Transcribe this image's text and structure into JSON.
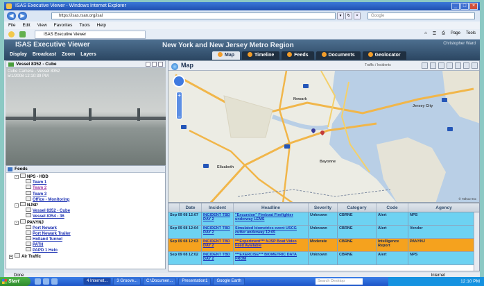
{
  "window": {
    "title": "ISAS Executive Viewer - Windows Internet Explorer"
  },
  "browser": {
    "url": "https://isas.rsan.org/isal",
    "search_placeholder": "Google",
    "menu": [
      "File",
      "Edit",
      "View",
      "Favorites",
      "Tools",
      "Help"
    ],
    "tab_label": "ISAS Executive Viewer",
    "commands": [
      "Page",
      "Tools"
    ]
  },
  "app": {
    "title": "ISAS Executive Viewer",
    "region": "New York and New Jersey Metro Region",
    "user": "Christopher Ward",
    "left_buttons": [
      "Display",
      "Broadcast",
      "Zoom",
      "Layers"
    ],
    "tabs": [
      {
        "label": "Map",
        "active": true
      },
      {
        "label": "Timeline",
        "active": false
      },
      {
        "label": "Feeds",
        "active": false
      },
      {
        "label": "Documents",
        "active": false
      },
      {
        "label": "Geolocator",
        "active": false
      }
    ]
  },
  "camera": {
    "header": "Vessel 8352 - Cube",
    "overlay_line1": "Cube Camera - Vessel 8352",
    "overlay_line2": "5/1/2008 12:10:39 PM"
  },
  "feeds": {
    "header": "Feeds",
    "tree": [
      {
        "level": 1,
        "toggle": "-",
        "text": "NPS - HDD",
        "link": false
      },
      {
        "level": 3,
        "text": "Team 1",
        "link": true,
        "visited": false
      },
      {
        "level": 3,
        "text": "Team 2",
        "link": true,
        "visited": true
      },
      {
        "level": 3,
        "text": "Team 3",
        "link": true,
        "visited": false
      },
      {
        "level": 3,
        "text": "Office - Monitoring",
        "link": true,
        "visited": false
      },
      {
        "level": 1,
        "toggle": "-",
        "text": "NJSP",
        "link": false
      },
      {
        "level": 3,
        "text": "Vessel 8352 - Cube",
        "link": true,
        "visited": false
      },
      {
        "level": 3,
        "text": "Vessel 8354 - 36",
        "link": true,
        "visited": false
      },
      {
        "level": 1,
        "toggle": "-",
        "text": "PANYNJ",
        "link": false
      },
      {
        "level": 3,
        "text": "Port Newark",
        "link": true,
        "visited": false
      },
      {
        "level": 3,
        "text": "Port Newark Trailer",
        "link": true,
        "visited": false
      },
      {
        "level": 3,
        "text": "Holland Tunnel",
        "link": true,
        "visited": false
      },
      {
        "level": 3,
        "text": "PATH",
        "link": true,
        "visited": false
      },
      {
        "level": 3,
        "text": "PAPD 1 Helo",
        "link": true,
        "visited": false
      },
      {
        "level": 0,
        "toggle": "+",
        "text": "Air Traffic",
        "link": false
      }
    ]
  },
  "map": {
    "title": "Map",
    "note": "Traffic / Incidents",
    "labels": [
      "Newark",
      "Jersey City",
      "Elizabeth",
      "Bayonne"
    ],
    "copyright": "© Yahoo! Inc"
  },
  "incidents": {
    "columns": [
      "Date",
      "Incident",
      "Headline",
      "Severity",
      "Category",
      "Code",
      "Agency"
    ],
    "rows": [
      {
        "style": "blue",
        "date": "Sep 09 08 12:07",
        "incident": "INCIDENT TBD DAY 2",
        "headline": "\"Excursion\" Fireboat Firefighter underway LEMS",
        "severity": "Unknown",
        "category": "CBRNE",
        "code": "Alert",
        "agency": "NPS"
      },
      {
        "style": "blue",
        "date": "Sep 09 08 12:04",
        "incident": "INCIDENT TBD DAY 2",
        "headline": "Simulated biometrics event USCG cutter underway 12:05",
        "severity": "Unknown",
        "category": "CBRNE",
        "code": "Alert",
        "agency": "Vendor"
      },
      {
        "style": "orange",
        "date": "Sep 09 08 12:03",
        "incident": "INCIDENT TBD DAY 2",
        "headline": "***Experiment*** NJSP Boat Video Feed Available",
        "severity": "Moderate",
        "category": "CBRNE",
        "code": "Intelligence Report",
        "agency": "PANYNJ"
      },
      {
        "style": "blue",
        "date": "Sep 09 08 12:02",
        "incident": "INCIDENT TBD DAY 2",
        "headline": "***EXERCISE*** BIOMETRIC DATA FROM",
        "severity": "Unknown",
        "category": "CBRNE",
        "code": "Alert",
        "agency": "NPS"
      }
    ]
  },
  "status": {
    "left": "Done",
    "zone": "Internet"
  },
  "taskbar": {
    "start": "Start",
    "tasks": [
      "4 Internet...",
      "3 Groove...",
      "C:\\Documen...",
      "Presentation1",
      "Google Earth"
    ],
    "search_placeholder": "Search Desktop",
    "clock": "12:10 PM"
  },
  "colors": {
    "row_blue": "#6dd2f2",
    "row_orange": "#f5a21e",
    "header_bg": "#2b4662"
  }
}
